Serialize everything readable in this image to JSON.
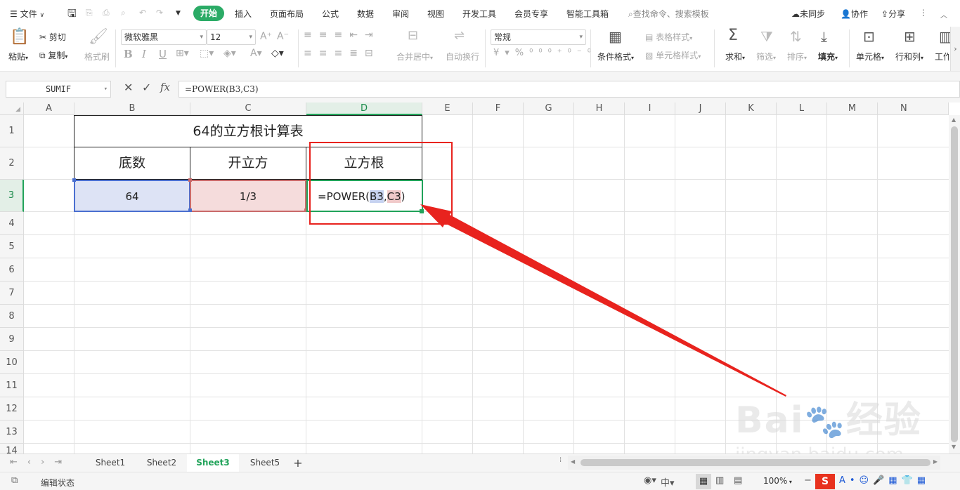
{
  "menubar": {
    "file": "文件",
    "active": "开始",
    "tabs": [
      "插入",
      "页面布局",
      "公式",
      "数据",
      "审阅",
      "视图",
      "开发工具",
      "会员专享",
      "智能工具箱"
    ],
    "search": "查找命令、搜索模板",
    "sync": "未同步",
    "collab": "协作",
    "share": "分享"
  },
  "ribbon": {
    "paste": "粘贴",
    "cut": "剪切",
    "copy": "复制",
    "format_painter": "格式刷",
    "font_name": "微软雅黑",
    "font_size": "12",
    "merge": "合并居中",
    "wrap": "自动换行",
    "number_format": "常规",
    "cond_format": "条件格式",
    "table_style": "表格样式",
    "cell_style": "单元格样式",
    "sum": "求和",
    "filter": "筛选",
    "sort": "排序",
    "fill": "填充",
    "cell": "单元格",
    "row_col": "行和列",
    "worksheet": "工作表"
  },
  "formula_bar": {
    "name_box": "SUMIF",
    "formula": "=POWER(B3,C3)",
    "fx": "fx"
  },
  "columns": [
    "A",
    "B",
    "C",
    "D",
    "E",
    "F",
    "G",
    "H",
    "I",
    "J",
    "K",
    "L",
    "M",
    "N"
  ],
  "rows": [
    "1",
    "2",
    "3",
    "4",
    "5",
    "6",
    "7",
    "8",
    "9",
    "10",
    "11",
    "12",
    "13",
    "14"
  ],
  "table": {
    "title": "64的立方根计算表",
    "headers": [
      "底数",
      "开立方",
      "立方根"
    ],
    "b3": "64",
    "c3": "1/3",
    "d3_prefix": "=POWER(",
    "d3_ref1": "B3",
    "d3_comma": ",",
    "d3_ref2": "C3",
    "d3_suffix": ")"
  },
  "sheets": [
    "Sheet1",
    "Sheet2",
    "Sheet3",
    "Sheet5"
  ],
  "active_sheet": "Sheet3",
  "status": {
    "mode": "编辑状态",
    "zoom": "100%"
  },
  "watermark": "Baidu经验 jingyan.baidu.com",
  "colors": {
    "accent": "#21a35a",
    "annotation": "#e8231e",
    "ref_blue": "#dde3f5",
    "ref_red": "#f5dcdc"
  }
}
